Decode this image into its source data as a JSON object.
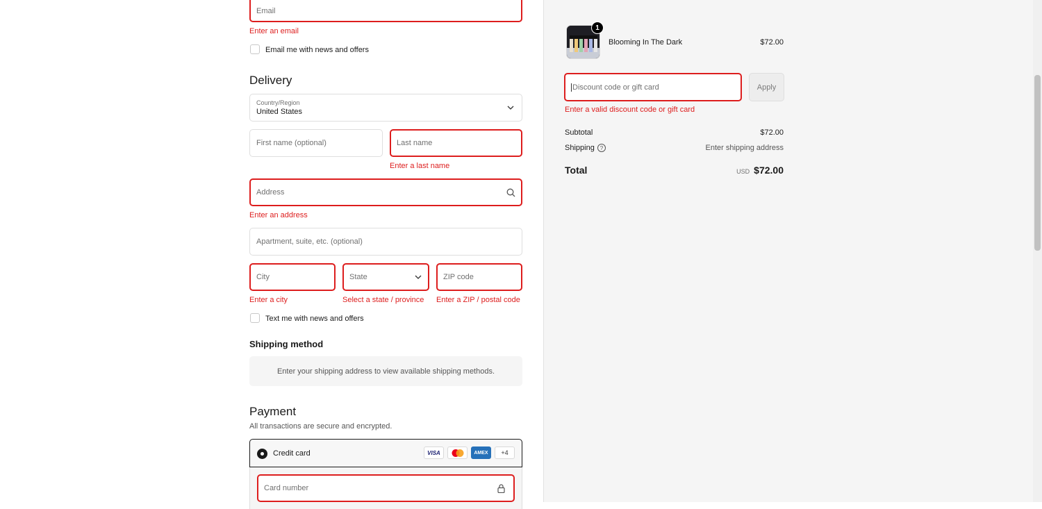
{
  "contact": {
    "email_placeholder": "Email",
    "email_error": "Enter an email",
    "news_label": "Email me with news and offers"
  },
  "delivery": {
    "heading": "Delivery",
    "country_label": "Country/Region",
    "country_value": "United States",
    "first_name_placeholder": "First name (optional)",
    "last_name_placeholder": "Last name",
    "last_name_error": "Enter a last name",
    "address_placeholder": "Address",
    "address_error": "Enter an address",
    "apartment_placeholder": "Apartment, suite, etc. (optional)",
    "city_placeholder": "City",
    "city_error": "Enter a city",
    "state_placeholder": "State",
    "state_error": "Select a state / province",
    "zip_placeholder": "ZIP code",
    "zip_error": "Enter a ZIP / postal code",
    "sms_label": "Text me with news and offers"
  },
  "shipping_method": {
    "heading": "Shipping method",
    "info": "Enter your shipping address to view available shipping methods."
  },
  "payment": {
    "heading": "Payment",
    "subtitle": "All transactions are secure and encrypted.",
    "credit_card_label": "Credit card",
    "cards": [
      "VISA",
      "",
      "AMEX"
    ],
    "more_cards": "+4",
    "card_number_placeholder": "Card number"
  },
  "summary": {
    "product_name": "Blooming In The Dark",
    "product_price": "$72.00",
    "product_qty": "1",
    "discount_placeholder": "Discount code or gift card",
    "apply_label": "Apply",
    "discount_error": "Enter a valid discount code or gift card",
    "subtotal_label": "Subtotal",
    "subtotal_value": "$72.00",
    "shipping_label": "Shipping",
    "shipping_value": "Enter shipping address",
    "total_label": "Total",
    "currency": "USD",
    "total_value": "$72.00"
  },
  "colors": {
    "error": "#dd1d1d",
    "summary_bg": "#f5f5f5"
  }
}
